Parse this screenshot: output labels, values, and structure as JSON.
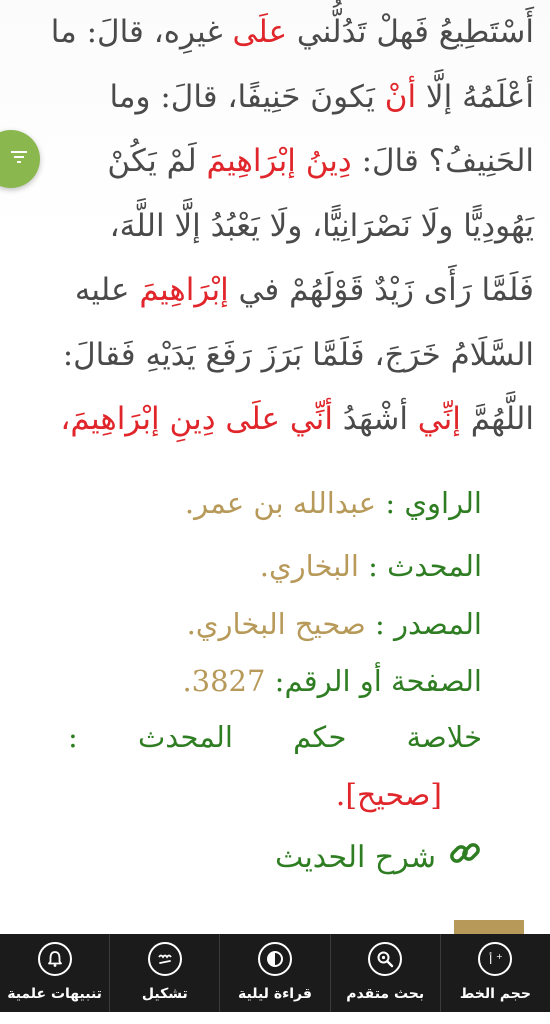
{
  "hadith": {
    "line1_a": "أَسْتَطِيعُ فَهلْ تَدُلُّني ",
    "line1_hl": "علَى",
    "line1_b": " غيرِه، قالَ: ما",
    "line2_a": "أعْلَمُهُ إلَّا ",
    "line2_hl": "أنْ",
    "line2_b": " يَكونَ حَنِيفًا، قالَ: وما",
    "line3_a": "الحَنِيفُ؟ قالَ: ",
    "line3_hl": "دِينُ إبْرَاهِيمَ",
    "line3_b": " لَمْ يَكُنْ",
    "line4": "يَهُودِيًّا ولَا نَصْرَانِيًّا، ولَا يَعْبُدُ إلَّا اللَّهَ،",
    "line5_a": "فَلَمَّا رَأَى زَيْدٌ قَوْلَهُمْ في ",
    "line5_hl": "إبْرَاهِيمَ",
    "line5_b": " عليه",
    "line6": "السَّلَامُ خَرَجَ، فَلَمَّا بَرَزَ رَفَعَ يَدَيْهِ فَقالَ:",
    "line7_a": "اللَّهُمَّ ",
    "line7_hl1": "إنِّي",
    "line7_b": " أشْهَدُ ",
    "line7_hl2": "أنِّي علَى دِينِ إبْرَاهِيمَ،"
  },
  "meta": {
    "narrator_label": "الراوي : ",
    "narrator_value": "عبدالله بن عمر.",
    "muhaddith_label": "المحدث : ",
    "muhaddith_value": "البخاري.",
    "source_label": "المصدر : ",
    "source_value": "صحيح البخاري.",
    "page_label": "الصفحة أو الرقم: ",
    "page_value": "3827.",
    "verdict_w1": "خلاصة",
    "verdict_w2": "حكم",
    "verdict_w3": "المحدث",
    "verdict_colon": ":",
    "verdict_value": "[صحيح].",
    "explain_label": "شرح الحديث"
  },
  "toolbar": [
    {
      "label": "حجم الخط",
      "icon": "font-size-icon"
    },
    {
      "label": "بحث متقدم",
      "icon": "advanced-search-icon"
    },
    {
      "label": "قراءة ليلية",
      "icon": "night-mode-icon"
    },
    {
      "label": "تشكيل",
      "icon": "tashkeel-icon"
    },
    {
      "label": "تنبيهات علمية",
      "icon": "bell-icon"
    }
  ],
  "colors": {
    "accent_green": "#2f7d22",
    "highlight_red": "#e0262b",
    "value_gold": "#b79a5a",
    "filter_green": "#8ab84f",
    "toolbar_bg": "#1b1b1b"
  }
}
